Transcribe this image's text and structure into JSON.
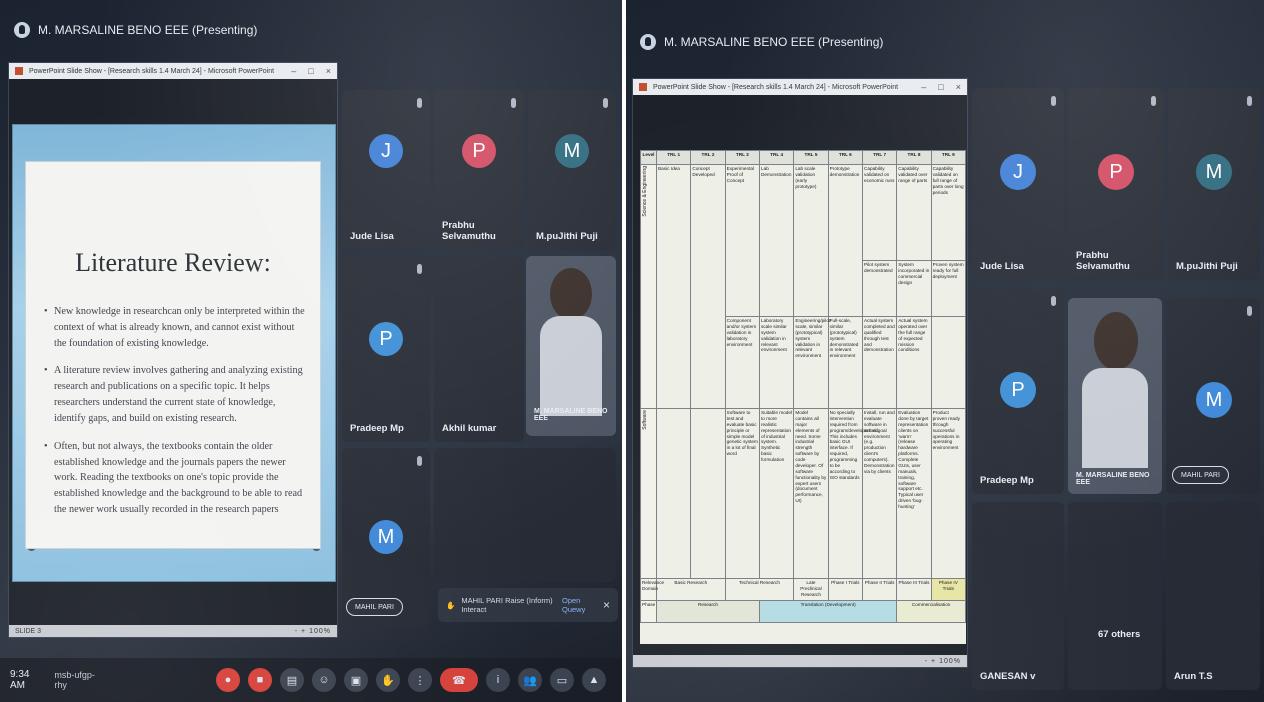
{
  "left": {
    "presenter": "M. MARSALINE BENO EEE (Presenting)",
    "window_title": "PowerPoint Slide Show - [Research skills 1.4 March 24] - Microsoft PowerPoint",
    "slide": {
      "title": "Literature Review:",
      "bullets": [
        "New knowledge in researchcan only be interpreted within the context of what is already known, and cannot exist without the foundation of existing knowledge.",
        "A literature review involves gathering and analyzing existing research and publications on a specific topic. It helps researchers understand the current state of knowledge, identify gaps, and build on existing research.",
        "Often, but not always, the textbooks contain the older established knowledge and the journals papers the newer work. Reading the textbooks on one's topic provide the established knowledge and the background to be able to read the newer work usually recorded in the research papers"
      ]
    },
    "footer_slide": "SLIDE 3",
    "footer_zoom": "- + 100%",
    "tiles": [
      {
        "initial": "J",
        "name": "Jude Lisa",
        "color": "#3f7fd6"
      },
      {
        "initial": "P",
        "name": "Prabhu Selvamuthu",
        "color": "#d24b62"
      },
      {
        "initial": "M",
        "name": "M.puJithi Puji",
        "color": "#2f6b7f"
      },
      {
        "initial": "P",
        "name": "Pradeep Mp",
        "color": "#3d8fd6"
      },
      {
        "initial": "",
        "name": "Akhil kumar",
        "color": "#262b35"
      },
      {
        "initial": "",
        "name": "M. MARSALINE BENO EEE",
        "color": "#4d5564"
      },
      {
        "initial": "M",
        "name": "",
        "color": "#3f89d8"
      },
      {
        "initial": "",
        "name": "",
        "color": "#262b35"
      }
    ],
    "chip": "MAHIL PARI",
    "toast": "MAHIL PARI Raise (Inform) Interact",
    "toast_action": "Open Quewy",
    "time": "9:34 AM",
    "meeting_code": "msb-ufgp-rhy"
  },
  "right": {
    "presenter": "M. MARSALINE BENO EEE (Presenting)",
    "window_title": "PowerPoint Slide Show - [Research skills 1.4 March 24] - Microsoft PowerPoint",
    "table": {
      "headers": [
        "Level",
        "TRL 1",
        "TRL 2",
        "TRL 3",
        "TRL 4",
        "TRL 5",
        "TRL 6",
        "TRL 7",
        "TRL 8",
        "TRL 9"
      ],
      "side_upper": "Science & Engineering",
      "side_lower": "Software",
      "row1": [
        "Basic Idea",
        "Concept Developed",
        "Experimental Proof of Concept",
        "Lab Demonstration",
        "Lab scale validation (early prototype)",
        "Prototype demonstration",
        "Capability validated on economic runs",
        "Capability validated over range of parts",
        "Capability validated on full range of parts over long periods"
      ],
      "row2": [
        "Pilot system demonstrated",
        "System incorporated in commercial design",
        "Proven system ready for full deployment"
      ],
      "row3": [
        "Component and/or system validation in laboratory environment",
        "Laboratory scale similar system validation in relevant environment",
        "Engineering/pilot-scale, similar (prototypical) system validation in relevant environment",
        "Full-scale, similar (prototypical) system demonstrated in relevant environment",
        "Actual system completed and qualified through test and demonstration",
        "Actual system operated over the full range of expected mission conditions"
      ],
      "row4": [
        "Software to test and evaluate basic principle or simple model genetic system in a lot of final word",
        "Suitable model to more realistic representation of industrial system. Synthetic basic formulation",
        "Model contains all major elements of need. Some industrial strength software by code developer. Of software functionality by expert users (document performance, UI)",
        "No specially intervention required from program/developer/end. This includes basic GUI interface. If required, programming to be according to ISO standards",
        "Install, run and evaluate software in actual goal environment (e.g. production client's computers). Demonstration via by clients",
        "Evaluation done by target representation clients on 'warm' (release hardware platforms. Complete GUIs, user manuals, training, software support etc. Typical user driven 'bug-hunting'",
        "Product proven ready through successful operations in operating environment"
      ],
      "relevance_label": "Relevance Domain",
      "relevance": [
        "Basic Research",
        "Technical Research",
        "Late Preclinical Research",
        "Phase I Trials",
        "Phase II Trials",
        "Phase III Trials",
        "Phase IV Trials"
      ],
      "phase_label": "Phase",
      "phases": [
        "Research",
        "Translation (Development)",
        "Commercialisation"
      ]
    },
    "tiles": [
      {
        "initial": "J",
        "name": "Jude Lisa",
        "color": "#3f7fd6"
      },
      {
        "initial": "P",
        "name": "Prabhu Selvamuthu",
        "color": "#d24b62"
      },
      {
        "initial": "M",
        "name": "M.puJithi Puji",
        "color": "#2f6b7f"
      },
      {
        "initial": "P",
        "name": "Pradeep Mp",
        "color": "#3d8fd6"
      },
      {
        "initial": "",
        "name": "M. MARSALINE BENO EEE",
        "color": "#4d5564"
      },
      {
        "initial": "M",
        "name": "",
        "color": "#3f89d8"
      },
      {
        "initial": "",
        "name": "GANESAN v",
        "color": "#262b35"
      },
      {
        "initial": "",
        "name": "67 others",
        "color": "#262b35"
      },
      {
        "initial": "",
        "name": "Arun T.S",
        "color": "#262b35"
      }
    ],
    "chip": "MAHIL PARI",
    "footer_zoom": "- + 100%"
  }
}
